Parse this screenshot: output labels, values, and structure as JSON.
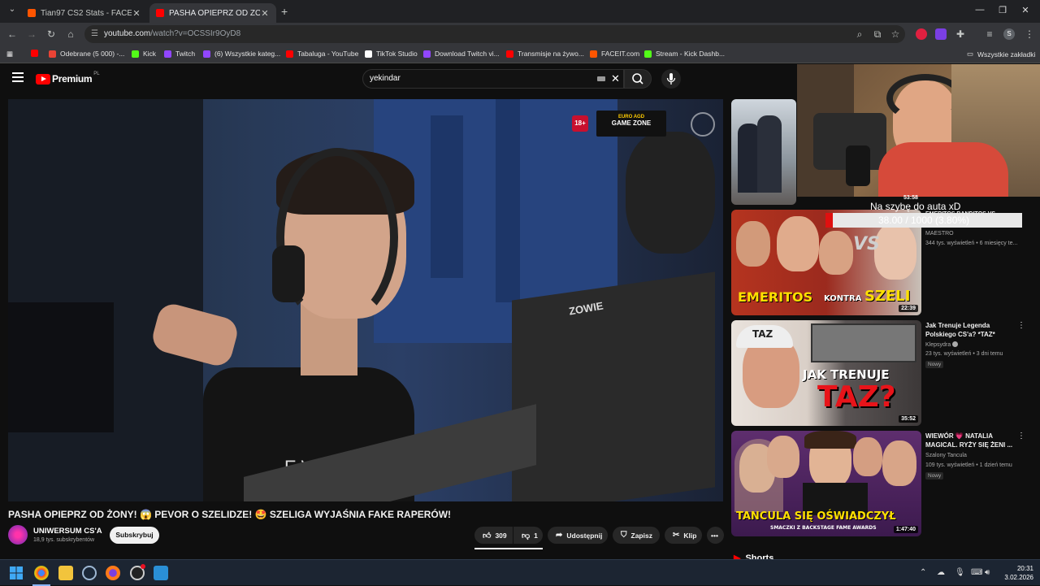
{
  "browser": {
    "tabs": [
      {
        "title": "Tian97 CS2 Stats - FACEIT.com",
        "favicon_color": "#ff5500",
        "active": false
      },
      {
        "title": "PASHA OPIEPRZ OD ŻONY! 😱",
        "favicon_color": "#ff0000",
        "active": true
      }
    ],
    "url_host": "youtube.com",
    "url_path": "/watch?v=OCSSIr9OyD8",
    "bookmarks": [
      {
        "label": "",
        "color": "#ff0000"
      },
      {
        "label": "Odebrane (5 000) -...",
        "color": "#ea4335"
      },
      {
        "label": "Kick",
        "color": "#53fc18"
      },
      {
        "label": "Twitch",
        "color": "#9146ff"
      },
      {
        "label": "(6) Wszystkie kateg...",
        "color": "#9146ff"
      },
      {
        "label": "Tabaluga - YouTube",
        "color": "#ff0000"
      },
      {
        "label": "TikTok Studio",
        "color": "#ffffff"
      },
      {
        "label": "Download Twitch vi...",
        "color": "#9146ff"
      },
      {
        "label": "Transmisje na żywo...",
        "color": "#ff0000"
      },
      {
        "label": "FACEIT.com",
        "color": "#ff5500"
      },
      {
        "label": "Stream - Kick Dashb...",
        "color": "#53fc18"
      }
    ],
    "all_bookmarks": "Wszystkie zakładki",
    "profile_initial": "S"
  },
  "youtube": {
    "logo": "Premium",
    "country": "PL",
    "search_query": "yekindar",
    "video": {
      "title": "PASHA OPIEPRZ OD ŻONY! 😱 PEVOR O SZELIDZE! 🤩 SZELIGA WYJAŚNIA FAKE RAPERÓW!",
      "age_badge": "18+",
      "sponsor_top": "EURO AGD",
      "sponsor_bottom": "GAME ZONE",
      "overlay_text_1": "EVNI",
      "overlay_text_2": "ZOWIE"
    },
    "channel": {
      "name": "UNIWERSUM CS'A",
      "subscribers": "18,9 tys. subskrybentów",
      "subscribe_label": "Subskrybuj"
    },
    "actions": {
      "likes": "309",
      "dislikes": "1",
      "share": "Udostępnij",
      "save": "Zapisz",
      "clip": "Klip"
    },
    "recommendations": [
      {
        "duration": "53:58",
        "title": "EMERITOS BANDITOS VS...",
        "meta1": "",
        "meta2": "",
        "badge": ""
      },
      {
        "duration": "22:39",
        "thumb_text_1": "EMERITOS",
        "thumb_text_2": "KONTRA",
        "thumb_text_3": "SZELI",
        "thumb_vs": "VS",
        "title": "",
        "meta1": "MAESTRO",
        "meta2": "344 tys. wyświetleń • 6 miesięcy te...",
        "badge": ""
      },
      {
        "duration": "35:52",
        "thumb_text_1": "JAK TRENUJE",
        "thumb_text_2": "TAZ?",
        "thumb_cap": "TAZ",
        "title": "Jak Trenuje Legenda Polskiego CS'a? *TAZ*",
        "meta1": "Klepsydra",
        "meta2": "23 tys. wyświetleń • 3 dni temu",
        "badge": "Nowy"
      },
      {
        "duration": "1:47:40",
        "thumb_text_1": "TANCULA SIĘ OŚWIADCZYŁ",
        "thumb_text_2": "SMACZKI Z BACKSTAGE FAME AWARDS",
        "title": "WIEWÓR 💗 NATALIA MAGICAL. RYŻY SIĘ ŻENI ...",
        "meta1": "Szalony Tancula",
        "meta2": "109 tys. wyświetleń • 1 dzień temu",
        "badge": "Nowy"
      }
    ],
    "shorts_label": "Shorts"
  },
  "overlay": {
    "message": "Na szybę do auta xD",
    "progress_text": "38.00 / 1000 (3.80%)",
    "progress_fraction": 0.038
  },
  "taskbar": {
    "time": "20:31",
    "date": "3.02.2026"
  }
}
